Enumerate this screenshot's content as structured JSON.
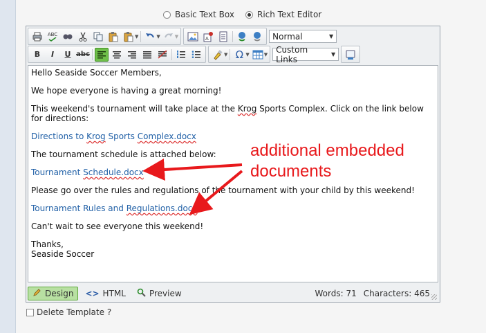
{
  "mode": {
    "basic_label": "Basic Text Box",
    "rich_label": "Rich Text Editor",
    "selected": "rich"
  },
  "toolbar": {
    "row1_icons": [
      "print-icon",
      "spellcheck-icon",
      "find-icon",
      "cut-icon",
      "copy-icon",
      "paste-icon",
      "paste-special-icon",
      "undo-icon",
      "redo-icon",
      "image-manager-icon",
      "flash-manager-icon",
      "document-manager-icon",
      "hyperlink-icon",
      "unlink-icon"
    ],
    "format_dropdown": "Normal",
    "row2_icons": [
      "bold-icon",
      "italic-icon",
      "underline-icon",
      "strikethrough-icon",
      "align-left-icon",
      "align-center-icon",
      "align-right-icon",
      "justify-icon",
      "remove-alignment-icon",
      "numbered-list-icon",
      "bulleted-list-icon",
      "format-painter-icon",
      "symbol-icon",
      "table-icon",
      "toggle-screen-icon"
    ],
    "links_dropdown": "Custom Links",
    "glyphs": {
      "bold": "B",
      "italic": "I",
      "underline": "U",
      "strike": "abc",
      "omega": "Ω",
      "abc_check": "ABC"
    }
  },
  "content": {
    "greeting": "Hello Seaside Soccer Members,",
    "p1": "We hope everyone is having a great morning!",
    "p2_a": "This weekend's tournament will take place at the ",
    "p2_krog": "Krog",
    "p2_b": " Sports Complex. Click on the link below for directions:",
    "link1_a": "Directions to ",
    "link1_krog": "Krog",
    "link1_b": " Sports ",
    "link1_c": "Complex.docx",
    "p3": "The tournament schedule is attached below:",
    "link2_a": "Tournament ",
    "link2_b": "Schedule.docx",
    "p4": "Please go over the rules and regulations of the tournament with your child by this weekend!",
    "link3_a": "Tournament Rules and ",
    "link3_b": "Regulations.docx",
    "p5": "Can't wait to see everyone this weekend!",
    "closing1": "Thanks,",
    "closing2": "Seaside Soccer"
  },
  "statusbar": {
    "design_label": "Design",
    "html_label": "HTML",
    "preview_label": "Preview",
    "words": "Words: 71",
    "characters": "Characters: 465"
  },
  "delete_template_label": "Delete Template ?",
  "annotation": {
    "line1": "additional embedded",
    "line2": "documents",
    "color": "#e8191c"
  }
}
